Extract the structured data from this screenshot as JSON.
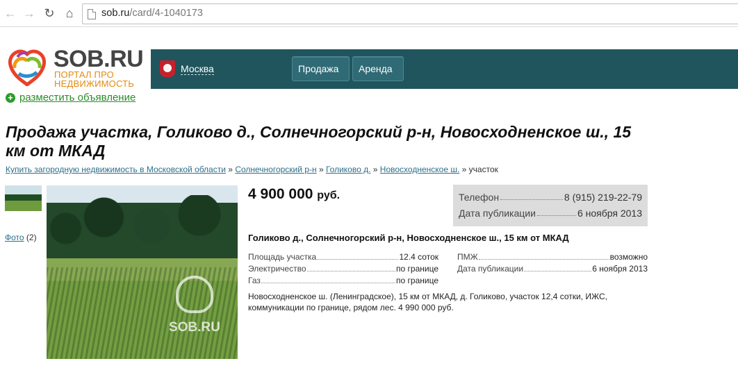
{
  "browser": {
    "url_host": "sob.ru",
    "url_path": "/card/4-1040173"
  },
  "logo": {
    "name": "SOB.RU",
    "sub": "ПОРТАЛ ПРО НЕДВИЖИМОСТЬ"
  },
  "header": {
    "city": "Москва",
    "menu": [
      {
        "label": "Продажа"
      },
      {
        "label": "Аренда"
      }
    ]
  },
  "post_link": "разместить объявление",
  "title": "Продажа участка, Голиково д., Солнечногорский р-н, Новосходненское ш., 15 км от МКАД",
  "breadcrumbs": [
    {
      "label": "Купить загородную недвижимость в Московской области"
    },
    {
      "label": "Солнечногорский р-н"
    },
    {
      "label": "Голиково д."
    },
    {
      "label": "Новосходненское ш."
    }
  ],
  "breadcrumb_current": "участок",
  "breadcrumb_sep": "»",
  "photos": {
    "link": "Фото",
    "count": "(2)",
    "watermark": "SOB.RU"
  },
  "price": {
    "value": "4 900 000",
    "currency": "руб."
  },
  "contact": {
    "phone_label": "Телефон",
    "phone": "8 (915) 219-22-79",
    "date_label": "Дата публикации",
    "date": "6 ноября 2013"
  },
  "address": "Голиково д., Солнечногорский р-н, Новосходненское ш., 15 км от МКАД",
  "params_left": [
    {
      "label": "Площадь участка",
      "value": "12.4 соток"
    },
    {
      "label": "Электричество",
      "value": "по границе"
    },
    {
      "label": "Газ",
      "value": "по границе"
    }
  ],
  "params_right": [
    {
      "label": "ПМЖ",
      "value": "возможно"
    },
    {
      "label": "Дата публикации",
      "value": "6 ноября 2013"
    }
  ],
  "description": "Новосходненское ш. (Ленинградское), 15 км от МКАД, д. Голиково, участок 12,4 сотки, ИЖС, коммуникации по границе, рядом лес. 4 990 000 руб."
}
